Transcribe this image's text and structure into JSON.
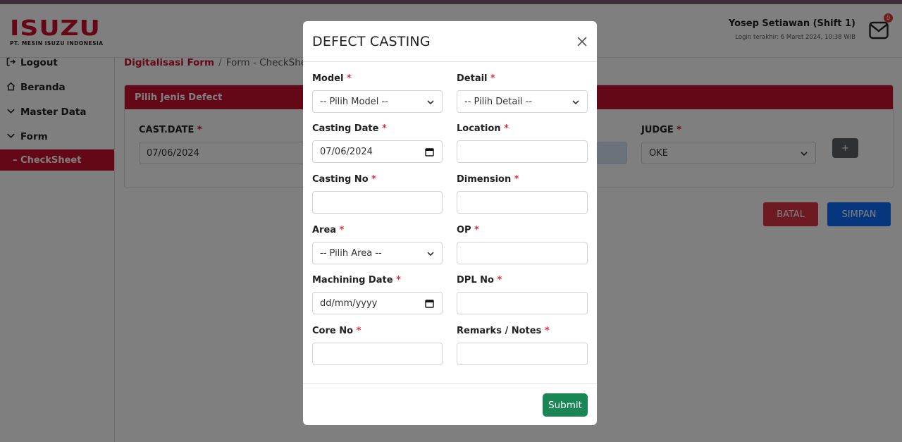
{
  "app": {
    "logo_text": "ISUZU",
    "logo_subtext": "PT. MESIN ISUZU INDONESIA",
    "brand_color": "#c8102e"
  },
  "header": {
    "user_name": "Yosep Setiawan (Shift 1)",
    "last_login": "Login terakhir: 6 Maret 2024, 10:38 WIB",
    "mail_badge_count": "0"
  },
  "sidebar": {
    "items": [
      {
        "label": "Logout",
        "icon": "logout-icon"
      },
      {
        "label": "Beranda",
        "icon": "home-icon"
      },
      {
        "label": "Master Data",
        "icon": "chevron-down-icon"
      },
      {
        "label": "Form",
        "icon": "chevron-down-icon"
      }
    ],
    "active_item": "–  CheckSheet"
  },
  "breadcrumb": {
    "root": "Digitalisasi Form",
    "separator": "/",
    "current": "Form - CheckSheet"
  },
  "card": {
    "title": "Pilih Jenis Defect",
    "cast_date_label": "CAST.DATE",
    "cast_date_value": "07/06/2024",
    "judge_label": "JUDGE",
    "judge_value": "OKE",
    "add_label": "+",
    "required_mark": "*"
  },
  "actions": {
    "batal": "BATAL",
    "simpan": "SIMPAN"
  },
  "modal": {
    "title": "DEFECT CASTING",
    "required_mark": "*",
    "fields": {
      "model": {
        "label": "Model",
        "value": "-- Pilih Model --"
      },
      "detail": {
        "label": "Detail",
        "value": "-- Pilih Detail --"
      },
      "casting_date": {
        "label": "Casting Date",
        "value": "07/06/2024"
      },
      "location": {
        "label": "Location",
        "value": ""
      },
      "casting_no": {
        "label": "Casting No",
        "value": ""
      },
      "dimension": {
        "label": "Dimension",
        "value": ""
      },
      "area": {
        "label": "Area",
        "value": "-- Pilih Area --"
      },
      "op": {
        "label": "OP",
        "value": ""
      },
      "machining_date": {
        "label": "Machining Date",
        "value": "dd/mm/yyyy"
      },
      "dpl_no": {
        "label": "DPL No",
        "value": ""
      },
      "core_no": {
        "label": "Core No",
        "value": ""
      },
      "remarks": {
        "label": "Remarks / Notes",
        "value": ""
      }
    },
    "submit_label": "Submit"
  },
  "colors": {
    "danger": "#dc3545",
    "primary": "#0d6efd",
    "success": "#198754",
    "secondary": "#5a6268"
  }
}
